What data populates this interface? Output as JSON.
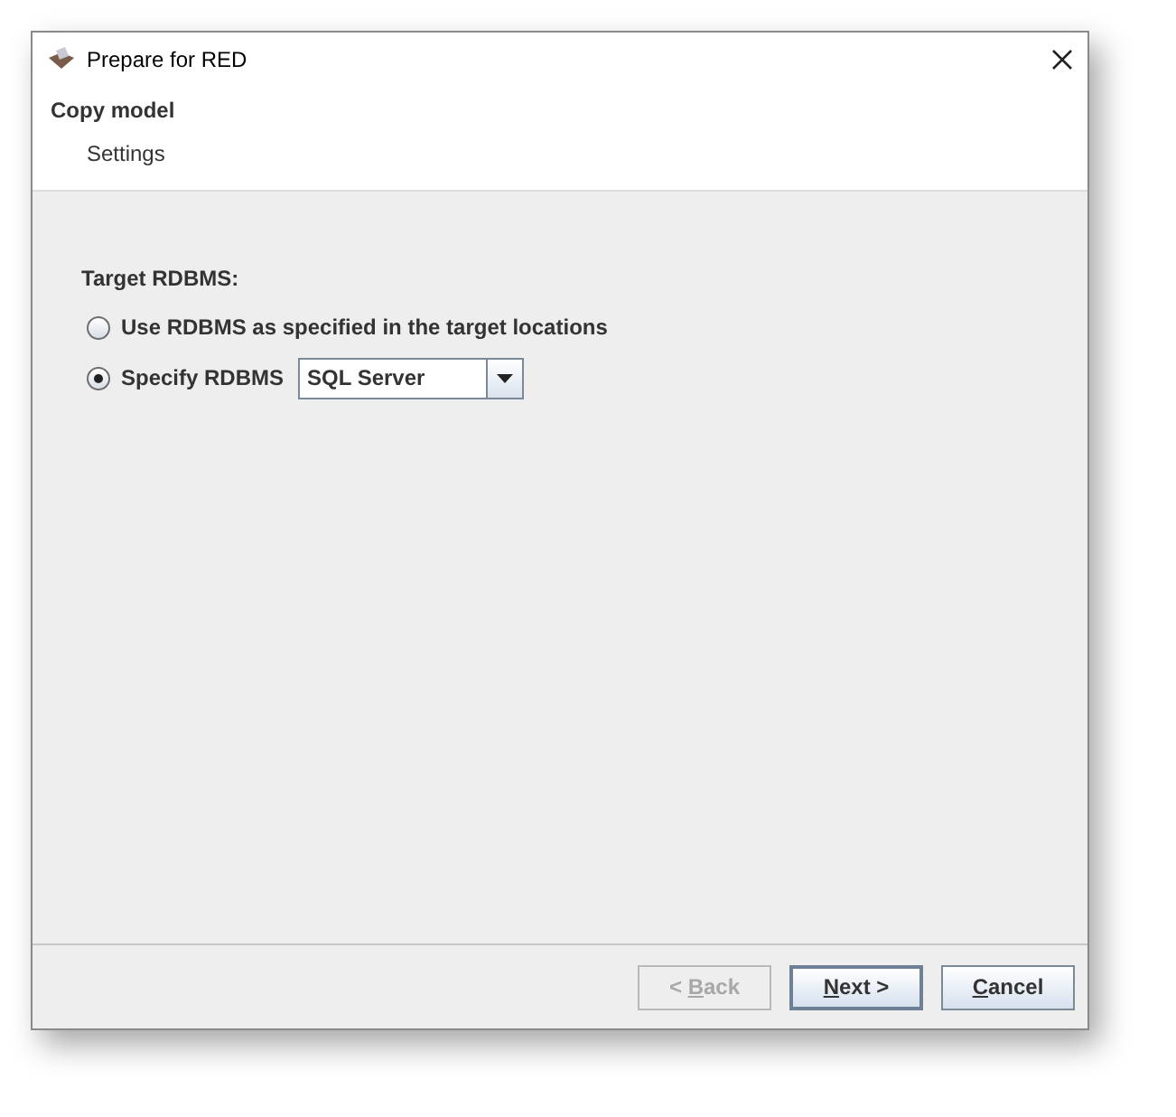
{
  "window": {
    "title": "Prepare for RED"
  },
  "header": {
    "title": "Copy model",
    "subtitle": "Settings"
  },
  "section_label": "Target RDBMS:",
  "options": [
    {
      "kind": "radio",
      "label": "Use RDBMS as specified in the target locations",
      "selected": false
    },
    {
      "kind": "radio_combo",
      "label": "Specify RDBMS",
      "selected": true,
      "combo_value": "SQL Server"
    }
  ],
  "buttons": [
    {
      "parts": [
        {
          "text": "< ",
          "mnemonic": false
        },
        {
          "text": "B",
          "mnemonic": true
        },
        {
          "text": "ack",
          "mnemonic": false
        }
      ],
      "disabled": true,
      "default": false
    },
    {
      "parts": [
        {
          "text": "N",
          "mnemonic": true
        },
        {
          "text": "ext >",
          "mnemonic": false
        }
      ],
      "disabled": false,
      "default": true
    },
    {
      "parts": [
        {
          "text": "C",
          "mnemonic": true
        },
        {
          "text": "ancel",
          "mnemonic": false
        }
      ],
      "disabled": false,
      "default": false
    }
  ]
}
